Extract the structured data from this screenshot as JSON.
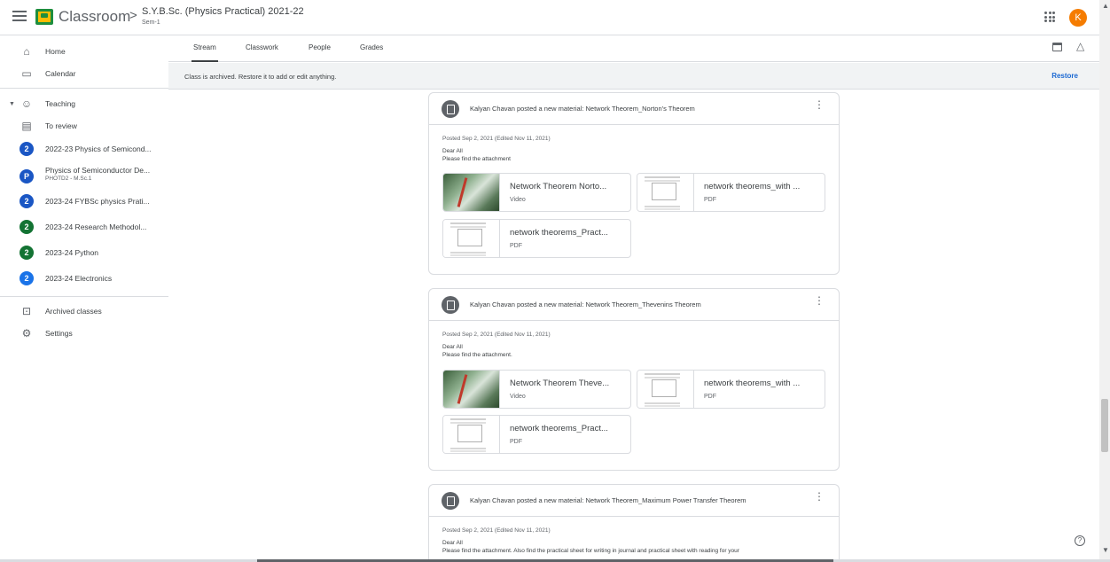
{
  "header": {
    "brand": "Classroom",
    "crumb_sep": ">",
    "class_title": "S.Y.B.Sc. (Physics Practical) 2021-22",
    "class_section": "Sem-1",
    "avatar_letter": "K",
    "avatar_color": "#f57c00"
  },
  "sidebar": {
    "home": "Home",
    "calendar": "Calendar",
    "teaching": "Teaching",
    "to_review": "To review",
    "classes": [
      {
        "badge": "2",
        "color": "#1a56c4",
        "label": "2022-23 Physics of Semicond...",
        "sub": ""
      },
      {
        "badge": "P",
        "color": "#1a56c4",
        "label": "Physics of Semiconductor De...",
        "sub": "PHOTD2 - M.Sc.1"
      },
      {
        "badge": "2",
        "color": "#1a56c4",
        "label": "2023-24 FYBSc physics Prati...",
        "sub": ""
      },
      {
        "badge": "2",
        "color": "#137333",
        "label": "2023-24 Research Methodol...",
        "sub": ""
      },
      {
        "badge": "2",
        "color": "#137333",
        "label": "2023-24 Python",
        "sub": ""
      },
      {
        "badge": "2",
        "color": "#1a73e8",
        "label": "2023-24 Electronics",
        "sub": ""
      }
    ],
    "archived": "Archived classes",
    "settings": "Settings"
  },
  "tabs": [
    "Stream",
    "Classwork",
    "People",
    "Grades"
  ],
  "archive_bar": {
    "message": "Class is archived. Restore it to add or edit anything.",
    "restore": "Restore"
  },
  "posts": [
    {
      "title": "Kalyan Chavan posted a new material: Network Theorem_Norton's Theorem",
      "posted": "Posted Sep 2, 2021 (Edited Nov 11, 2021)",
      "line1": "Dear All",
      "line2": "Please find the attachment",
      "attachments": [
        {
          "name": "Network Theorem Norto...",
          "type": "Video"
        },
        {
          "name": "network theorems_with ...",
          "type": "PDF"
        },
        {
          "name": "network theorems_Pract...",
          "type": "PDF"
        }
      ]
    },
    {
      "title": "Kalyan Chavan posted a new material: Network Theorem_Thevenins Theorem",
      "posted": "Posted Sep 2, 2021 (Edited Nov 11, 2021)",
      "line1": "Dear All",
      "line2": "Please find the attachment.",
      "attachments": [
        {
          "name": "Network Theorem Theve...",
          "type": "Video"
        },
        {
          "name": "network theorems_with ...",
          "type": "PDF"
        },
        {
          "name": "network theorems_Pract...",
          "type": "PDF"
        }
      ]
    },
    {
      "title": "Kalyan Chavan posted a new material: Network Theorem_Maximum Power Transfer Theorem",
      "posted": "Posted Sep 2, 2021 (Edited Nov 11, 2021)",
      "line1": "Dear All",
      "line2": "Please find the attachment. Also find the practical sheet for writing in journal and practical sheet with reading for your",
      "attachments": []
    }
  ],
  "help": "?"
}
